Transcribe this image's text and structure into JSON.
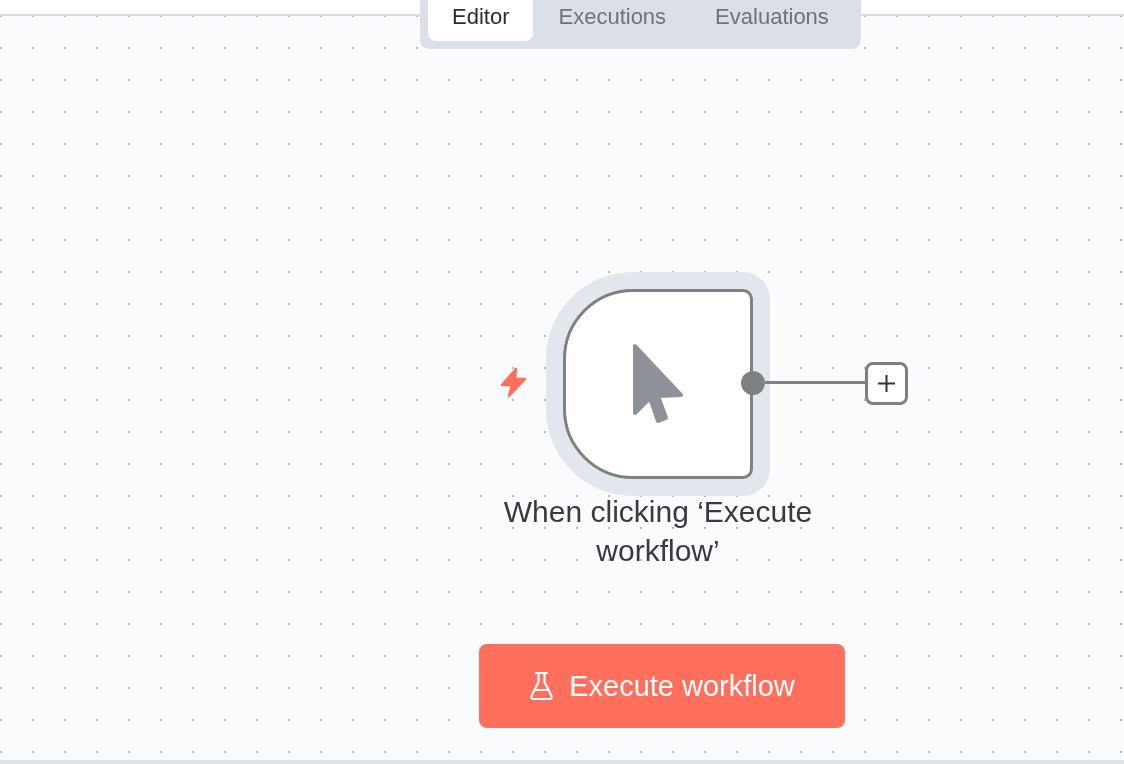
{
  "tabs": [
    {
      "label": "Editor",
      "selected": true
    },
    {
      "label": "Executions",
      "selected": false
    },
    {
      "label": "Evaluations",
      "selected": false
    }
  ],
  "canvas": {
    "nodes": [
      {
        "kind": "trigger",
        "label": "When clicking ‘Execute workflow’",
        "selected": true
      }
    ]
  },
  "execute_button": {
    "label": "Execute workflow"
  }
}
